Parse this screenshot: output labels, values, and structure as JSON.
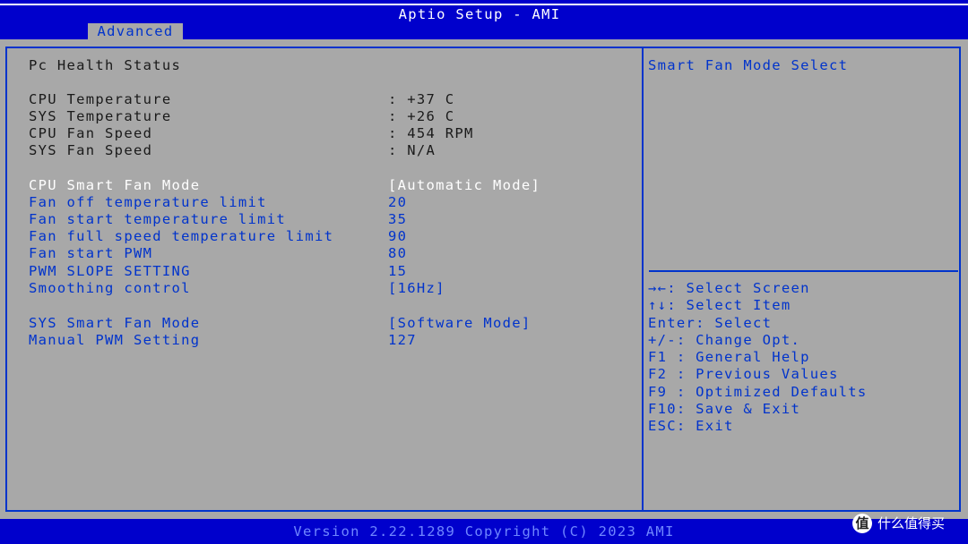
{
  "header": {
    "title": "Aptio Setup - AMI",
    "active_tab": "Advanced"
  },
  "main": {
    "section_title": "Pc Health Status",
    "status": [
      {
        "label": "CPU Temperature",
        "value": ": +37 C"
      },
      {
        "label": "SYS Temperature",
        "value": ": +26 C"
      },
      {
        "label": "CPU Fan Speed",
        "value": ": 454 RPM"
      },
      {
        "label": "SYS Fan Speed",
        "value": ": N/A"
      }
    ],
    "cpu_fan": [
      {
        "label": "CPU Smart Fan Mode",
        "value": "[Automatic Mode]"
      },
      {
        "label": "Fan off temperature limit",
        "value": "20"
      },
      {
        "label": "Fan start temperature limit",
        "value": "35"
      },
      {
        "label": "Fan full speed temperature limit",
        "value": "90"
      },
      {
        "label": "Fan start PWM",
        "value": "80"
      },
      {
        "label": "PWM SLOPE SETTING",
        "value": "15"
      },
      {
        "label": "Smoothing control",
        "value": "[16Hz]"
      }
    ],
    "sys_fan": [
      {
        "label": "SYS Smart Fan Mode",
        "value": "[Software Mode]"
      },
      {
        "label": "Manual PWM Setting",
        "value": "127"
      }
    ]
  },
  "help": {
    "description": "Smart Fan Mode Select",
    "keys": [
      "→←: Select Screen",
      "↑↓: Select Item",
      "Enter: Select",
      "+/-: Change Opt.",
      "F1 : General Help",
      "F2 : Previous Values",
      "F9 : Optimized Defaults",
      "F10: Save & Exit",
      "ESC: Exit"
    ]
  },
  "footer": {
    "version": "Version 2.22.1289 Copyright (C) 2023 AMI"
  },
  "watermark": {
    "logo_glyph": "值",
    "text": "什么值得买"
  },
  "colors": {
    "bios_blue": "#0033cc",
    "panel_gray": "#a8a8a8",
    "selected_text": "#ffffff"
  }
}
